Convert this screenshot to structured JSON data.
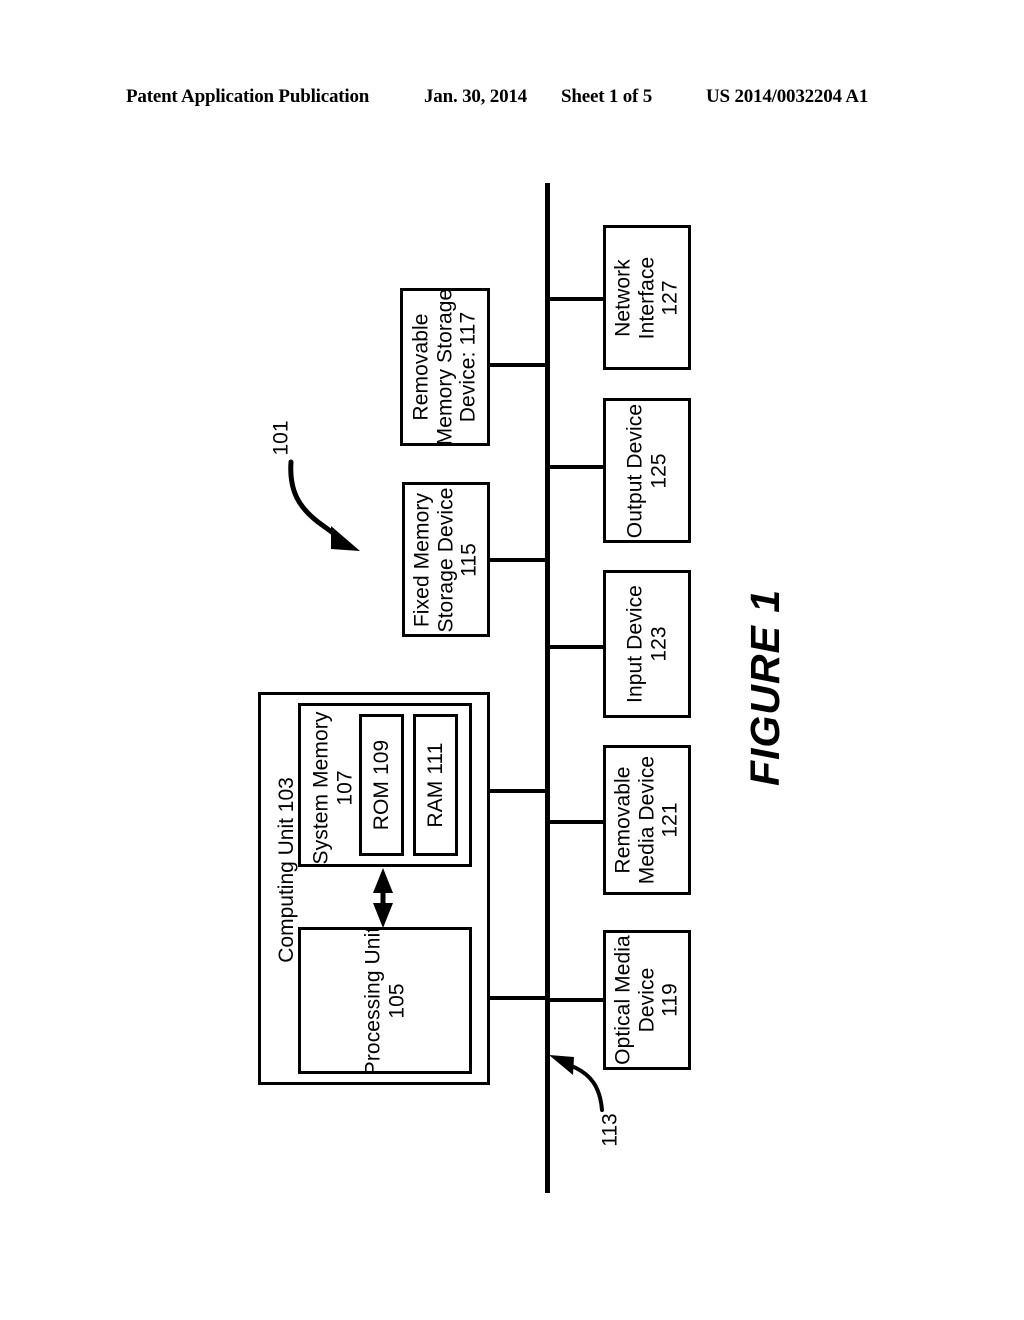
{
  "header": {
    "publication": "Patent Application Publication",
    "date": "Jan. 30, 2014",
    "sheet": "Sheet 1 of 5",
    "patent_number": "US 2014/0032204 A1"
  },
  "figure": {
    "caption": "FIGURE 1",
    "system_callout": "101",
    "bus_callout": "113",
    "computing_unit": {
      "label": "Computing Unit 103",
      "system_memory": {
        "label_line1": "System Memory",
        "label_line2": "107",
        "rom": "ROM 109",
        "ram": "RAM 111"
      },
      "processing_unit": {
        "label_line1": "Processing Unit",
        "label_line2": "105"
      }
    },
    "storage_devices": [
      {
        "name": "fixed-memory-storage-device",
        "line1": "Fixed Memory",
        "line2": "Storage Device",
        "line3": "115"
      },
      {
        "name": "removable-memory-storage-device",
        "line1": "Removable",
        "line2": "Memory Storage",
        "line3": "Device: 117"
      }
    ],
    "peripherals": [
      {
        "name": "optical-media-device",
        "line1": "Optical Media",
        "line2": "Device",
        "line3": "119"
      },
      {
        "name": "removable-media-device",
        "line1": "Removable",
        "line2": "Media Device",
        "line3": "121"
      },
      {
        "name": "input-device",
        "line1": "Input Device",
        "line2": "123",
        "line3": ""
      },
      {
        "name": "output-device",
        "line1": "Output Device",
        "line2": "125",
        "line3": ""
      },
      {
        "name": "network-interface",
        "line1": "Network",
        "line2": "Interface",
        "line3": "127"
      }
    ],
    "colors": {
      "ink": "#000000",
      "paper": "#ffffff"
    }
  }
}
